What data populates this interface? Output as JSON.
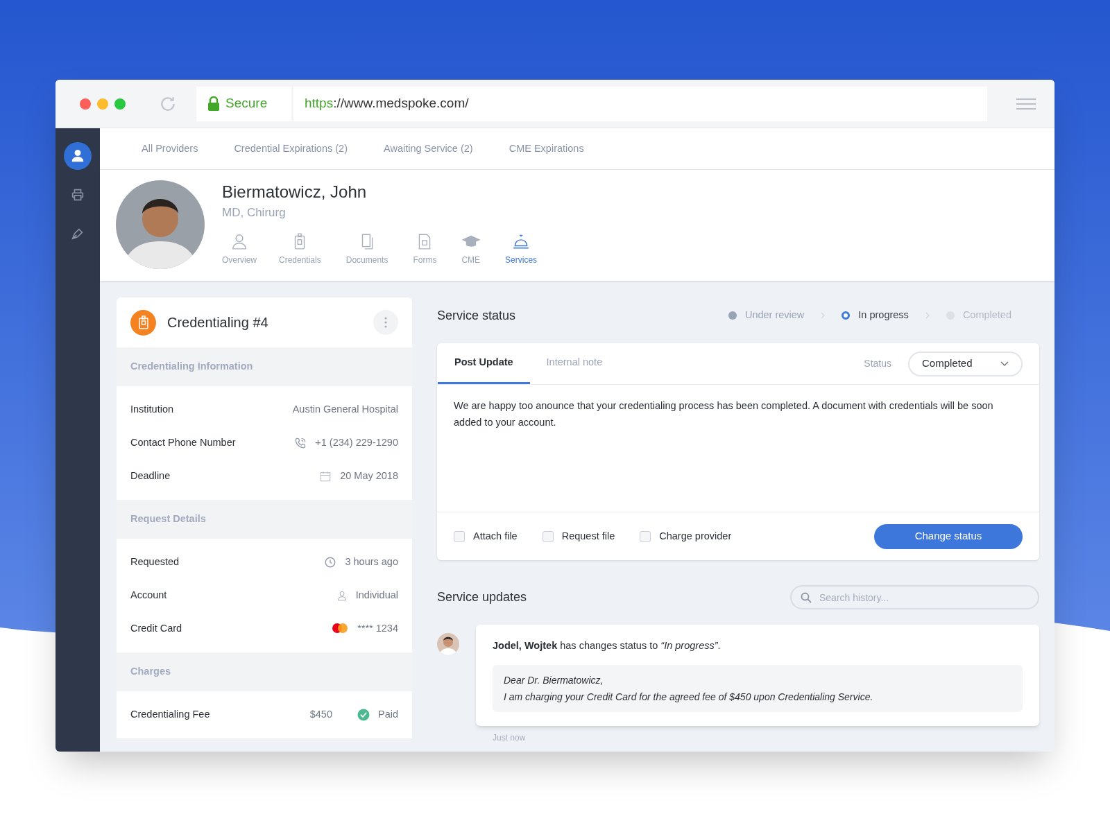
{
  "browser": {
    "secure_label": "Secure",
    "url_scheme": "https",
    "url_rest": "://www.medspoke.com/"
  },
  "sidebar": {
    "items": [
      {
        "selected": true
      },
      {
        "selected": false
      },
      {
        "selected": false
      }
    ]
  },
  "top_tabs": [
    {
      "label": "All Providers"
    },
    {
      "label": "Credential Expirations (2)"
    },
    {
      "label": "Awaiting Service (2)"
    },
    {
      "label": "CME Expirations"
    }
  ],
  "profile": {
    "name": "Biermatowicz, John",
    "subtitle": "MD, Chirurg",
    "tabs": [
      {
        "label": "Overview",
        "selected": false
      },
      {
        "label": "Credentials",
        "selected": false
      },
      {
        "label": "Documents",
        "selected": false
      },
      {
        "label": "Forms",
        "selected": false
      },
      {
        "label": "CME",
        "selected": false
      },
      {
        "label": "Services",
        "selected": true
      }
    ]
  },
  "card": {
    "title": "Credentialing #4",
    "sections": [
      {
        "heading": "Credentialing Information",
        "rows": [
          {
            "kind": "plain",
            "label": "Institution",
            "value": "Austin General Hospital"
          },
          {
            "kind": "phone",
            "label": "Contact Phone Number",
            "value": "+1 (234) 229-1290"
          },
          {
            "kind": "date",
            "label": "Deadline",
            "value": "20 May 2018"
          }
        ]
      },
      {
        "heading": "Request Details",
        "rows": [
          {
            "kind": "time",
            "label": "Requested",
            "value": "3 hours ago"
          },
          {
            "kind": "account",
            "label": "Account",
            "value": "Individual"
          },
          {
            "kind": "card",
            "label": "Credit Card",
            "value": "**** 1234"
          }
        ]
      },
      {
        "heading": "Charges",
        "rows": [
          {
            "kind": "fee",
            "label": "Credentialing Fee",
            "amount": "$450",
            "value": "Paid"
          }
        ]
      }
    ]
  },
  "service_status": {
    "title": "Service status",
    "steps": [
      {
        "label": "Under review",
        "done": true,
        "selected": false
      },
      {
        "label": "In progress",
        "done": false,
        "selected": true
      },
      {
        "label": "Completed",
        "done": false,
        "selected": false
      }
    ]
  },
  "editor": {
    "tabs": [
      {
        "label": "Post Update",
        "selected": true
      },
      {
        "label": "Internal note",
        "selected": false
      }
    ],
    "status_label": "Status",
    "status_value": "Completed",
    "message": "We are happy too anounce that your credentialing process has been completed. A document with credentials will be soon added to your account.",
    "checkboxes": [
      {
        "label": "Attach file",
        "checked": false
      },
      {
        "label": "Request file",
        "checked": false
      },
      {
        "label": "Charge provider",
        "checked": false
      }
    ],
    "button": "Change status"
  },
  "updates": {
    "title": "Service updates",
    "search_placeholder": "Search history...",
    "entries": [
      {
        "text": "**Jodel, Wojtek** has changes status to *“In progress”*.",
        "quote_lines": [
          "Dear Dr. Biermatowicz,",
          "I am charging your Credit Card for the agreed fee of $450 upon Credentialing Service."
        ],
        "time": "Just now"
      }
    ]
  }
}
